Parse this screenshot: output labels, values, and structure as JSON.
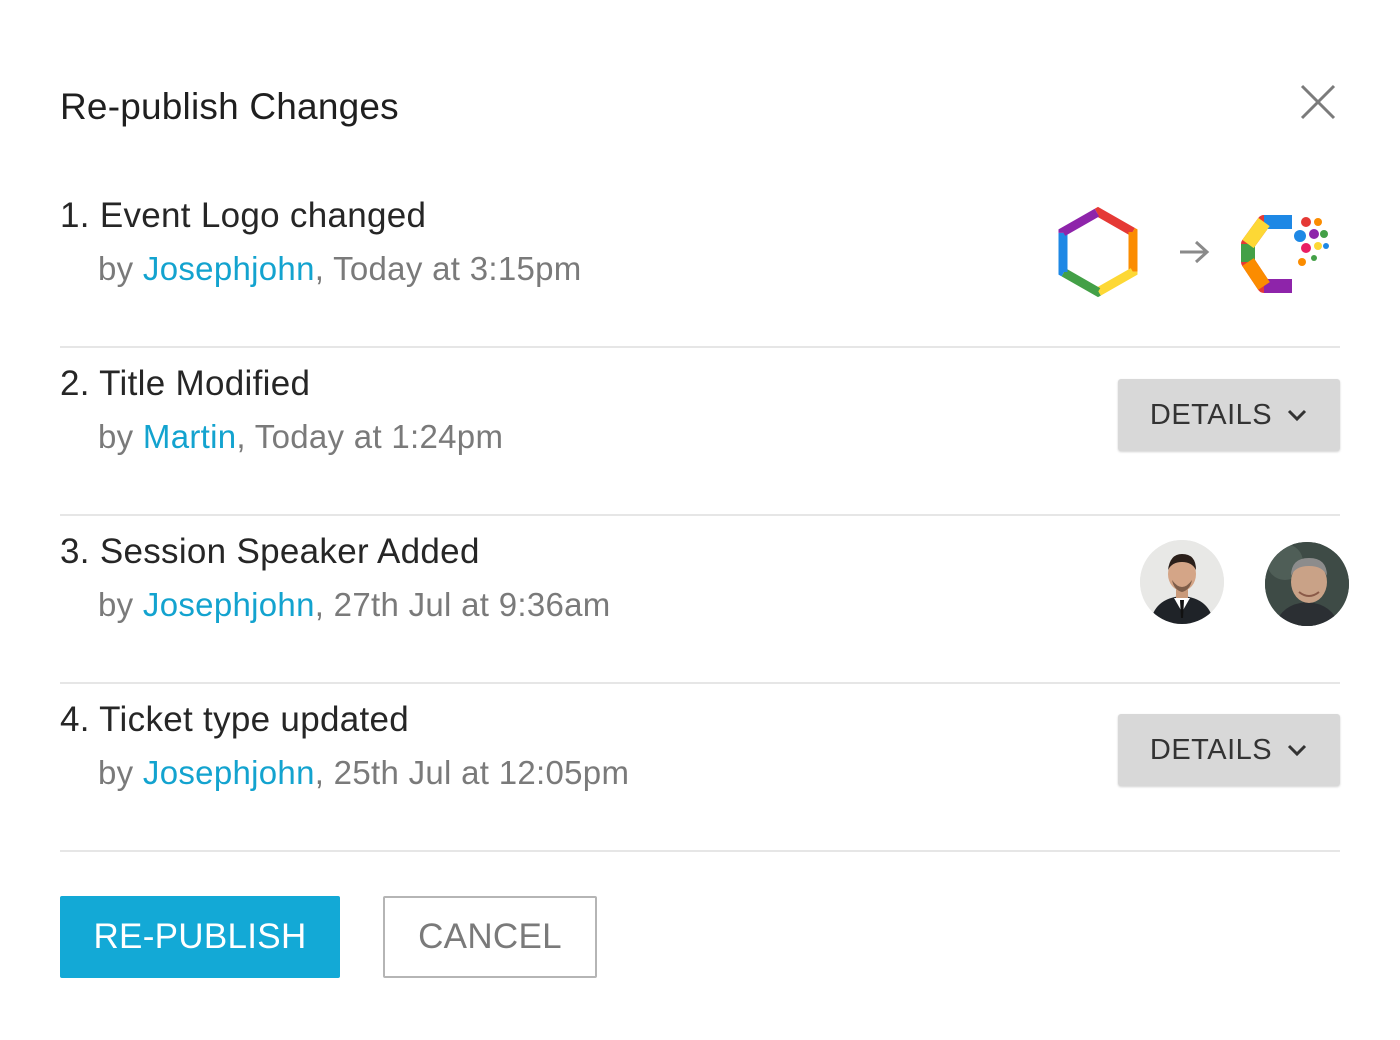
{
  "dialog": {
    "title": "Re-publish Changes",
    "close_icon": "close-icon"
  },
  "changes": [
    {
      "title": "1. Event Logo changed",
      "by": "by ",
      "author": "Josephjohn",
      "time": ", Today at 3:15pm",
      "preview": "logo-compare"
    },
    {
      "title": "2. Title Modified",
      "by": "by ",
      "author": "Martin",
      "time": ", Today at 1:24pm",
      "details_label": "DETAILS"
    },
    {
      "title": "3. Session Speaker Added",
      "by": "by ",
      "author": "Josephjohn",
      "time": ", 27th Jul at 9:36am",
      "preview": "speaker-avatars"
    },
    {
      "title": "4. Ticket type updated",
      "by": "by ",
      "author": "Josephjohn",
      "time": ", 25th Jul at 12:05pm",
      "details_label": "DETAILS"
    }
  ],
  "actions": {
    "republish_label": "RE-PUBLISH",
    "cancel_label": "CANCEL"
  },
  "colors": {
    "accent": "#13a9d6",
    "link": "#13a3cf",
    "details_bg": "#d8d8d8",
    "divider": "#e6e6e6"
  },
  "icons": {
    "close": "close-icon",
    "arrow": "arrow-right-icon",
    "chevron": "chevron-down-icon"
  }
}
